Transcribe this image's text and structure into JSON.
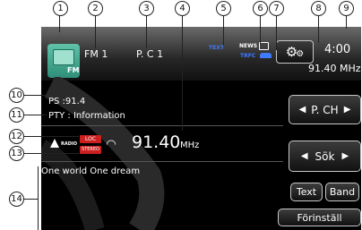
{
  "callouts": [
    "1",
    "2",
    "3",
    "4",
    "5",
    "6",
    "7",
    "8",
    "9",
    "10",
    "11",
    "12",
    "13",
    "14"
  ],
  "header": {
    "source_label": "FM",
    "band": "FM  1",
    "preset": "P. C  1",
    "text_indicator": "TEXT",
    "news_indicator": "NEWS",
    "traffic_indicator": "TRFC",
    "clock": "4:00",
    "frequency_small": "91.40 MHz"
  },
  "info": {
    "ps": "PS  :91.4",
    "pty": "PTY : Information",
    "radio_label": "RADIO",
    "loc_badge": "LOC",
    "stereo_badge": "STEREO",
    "frequency_value": "91.40",
    "frequency_unit": "MHz",
    "radio_text": "One world One dream"
  },
  "buttons": {
    "pch": "P. CH",
    "search": "Sök",
    "text": "Text",
    "band": "Band",
    "preset": "Förinställ"
  },
  "colors": {
    "indicator_blue": "#2f62d8",
    "badge_red": "#cc1f1f",
    "icon_teal": "#3aa58d"
  }
}
